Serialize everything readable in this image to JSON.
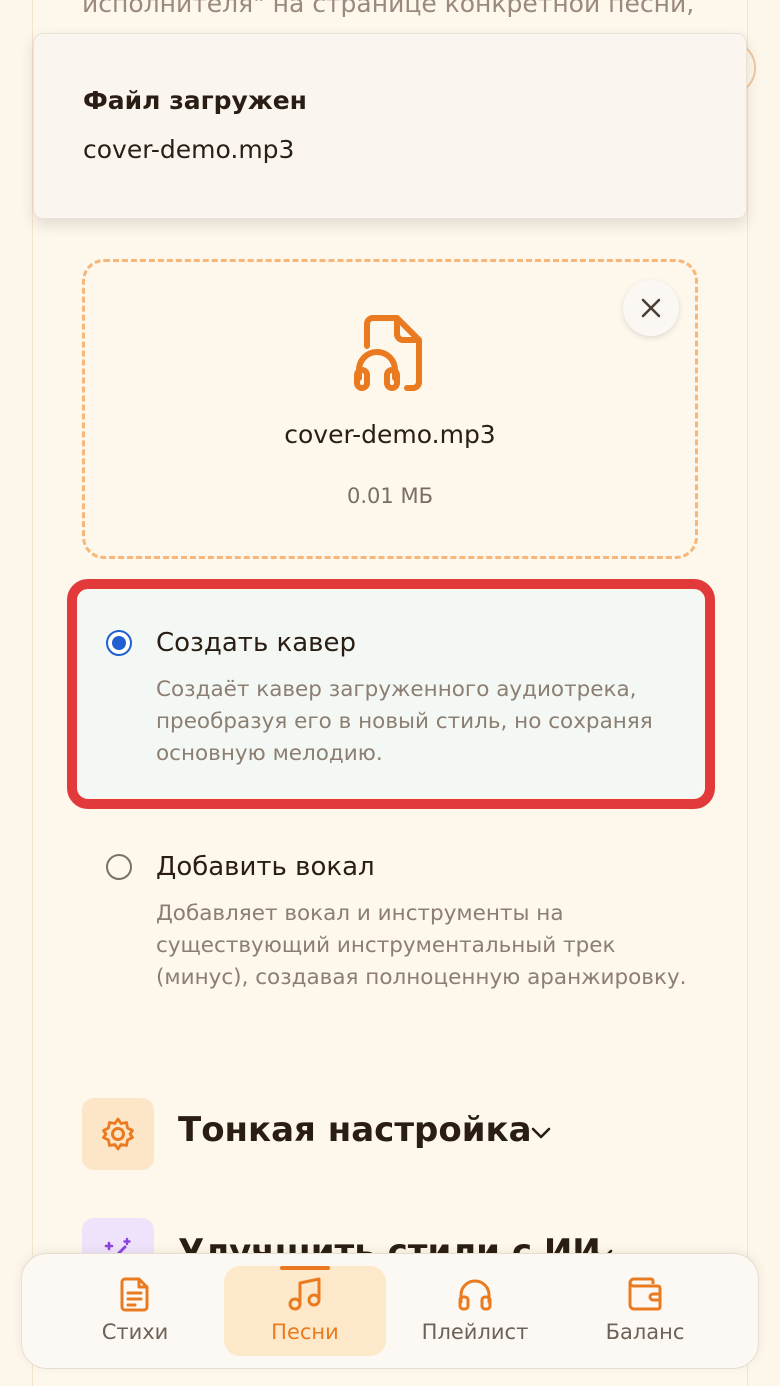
{
  "page": {
    "top_text": "исполнителя\" на странице конкретной песни,"
  },
  "toast": {
    "title": "Файл загружен",
    "message": "cover-demo.mp3"
  },
  "file": {
    "name": "cover-demo.mp3",
    "size": "0.01 МБ",
    "icon": "audio-file-icon"
  },
  "options": [
    {
      "title": "Создать кавер",
      "description": "Создаёт кавер загруженного аудиотрека, преобразуя его в новый стиль, но сохраняя основную мелодию.",
      "selected": true
    },
    {
      "title": "Добавить вокал",
      "description": "Добавляет вокал и инструменты на существующий инструментальный трек (минус), создавая полноценную аранжировку.",
      "selected": false
    }
  ],
  "sections": [
    {
      "title": "Тонкая настройка",
      "icon": "gear-icon"
    },
    {
      "title": "Улучшить стили с ИИ",
      "icon": "magic-wand-icon"
    }
  ],
  "bottom_nav": [
    {
      "label": "Стихи",
      "icon": "document-icon",
      "active": false
    },
    {
      "label": "Песни",
      "icon": "music-note-icon",
      "active": true
    },
    {
      "label": "Плейлист",
      "icon": "headphones-icon",
      "active": false
    },
    {
      "label": "Баланс",
      "icon": "wallet-icon",
      "active": false
    }
  ],
  "colors": {
    "accent": "#ea7a1f",
    "highlight_border": "#e23a3a",
    "radio_selected": "#1f5fd1",
    "background": "#fdf6ea"
  }
}
